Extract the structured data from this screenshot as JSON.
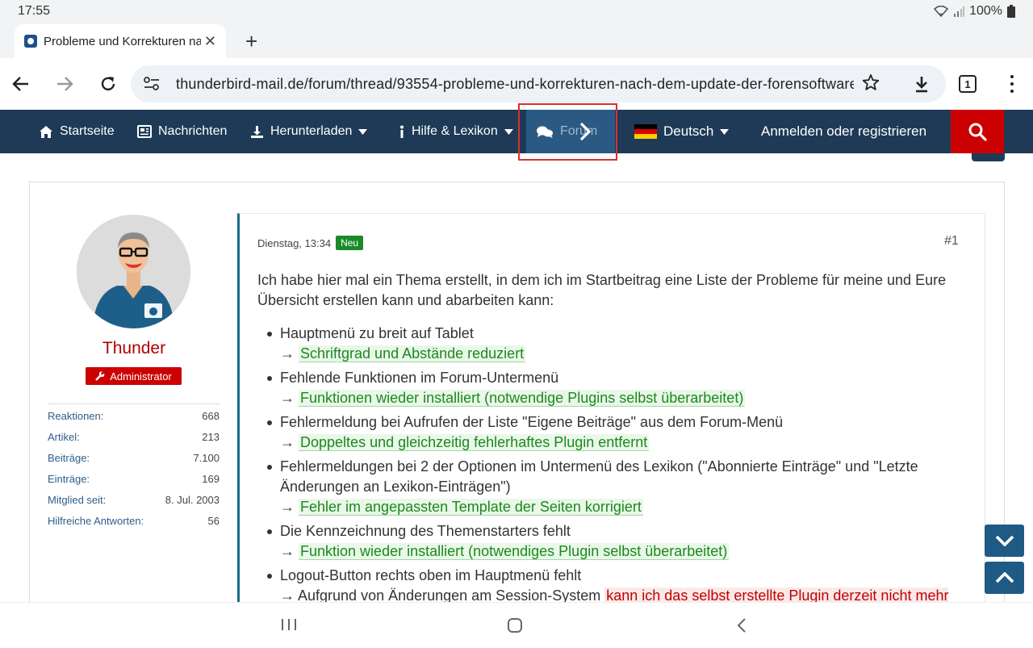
{
  "status_bar": {
    "time": "17:55",
    "battery": "100%"
  },
  "tab": {
    "title": "Probleme und Korrekturen nach dem Update"
  },
  "toolbar": {
    "url": "thunderbird-mail.de/forum/thread/93554-probleme-und-korrekturen-nach-dem-update-der-forensoftware",
    "tab_count": "1"
  },
  "nav": {
    "home": "Startseite",
    "news": "Nachrichten",
    "download": "Herunterladen",
    "help": "Hilfe & Lexikon",
    "forum": "Forum",
    "language": "Deutsch",
    "login": "Anmelden oder registrieren"
  },
  "user": {
    "name": "Thunder",
    "role": "Administrator",
    "stats": [
      {
        "label": "Reaktionen:",
        "value": "668"
      },
      {
        "label": "Artikel:",
        "value": "213"
      },
      {
        "label": "Beiträge:",
        "value": "7.100"
      },
      {
        "label": "Einträge:",
        "value": "169"
      },
      {
        "label": "Mitglied seit:",
        "value": "8. Jul. 2003"
      },
      {
        "label": "Hilfreiche Antworten:",
        "value": "56"
      }
    ]
  },
  "post": {
    "date": "Dienstag, 13:34",
    "badge": "Neu",
    "number": "#1",
    "intro": "Ich habe hier mal ein Thema erstellt, in dem ich im Startbeitrag eine Liste der Probleme für meine und Eure Übersicht erstellen kann und abarbeiten kann:",
    "arrow": "→",
    "items": [
      {
        "problem": "Hauptmenü zu breit auf Tablet",
        "fix": "Schriftgrad und Abstände reduziert"
      },
      {
        "problem": "Fehlende Funktionen im Forum-Untermenü",
        "fix": "Funktionen wieder installiert (notwendige Plugins selbst überarbeitet)"
      },
      {
        "problem": "Fehlermeldung bei Aufrufen der Liste \"Eigene Beiträge\" aus dem Forum-Menü",
        "fix": "Doppeltes und gleichzeitig fehlerhaftes Plugin entfernt"
      },
      {
        "problem": "Fehlermeldungen bei 2 der Optionen im Untermenü des Lexikon (\"Abonnierte Einträge\" und \"Letzte Änderungen an Lexikon-Einträgen\")",
        "fix": "Fehler im angepassten Template der Seiten korrigiert"
      },
      {
        "problem": "Die Kennzeichnung des Themenstarters fehlt",
        "fix": "Funktion wieder installiert (notwendiges Plugin selbst überarbeitet)"
      },
      {
        "problem": "Logout-Button rechts oben im Hauptmenü fehlt",
        "note": "Aufgrund von Änderungen am Session-System",
        "fix": "kann ich das selbst erstellte Plugin derzeit nicht mehr zum"
      }
    ]
  },
  "colors": {
    "nav_bg": "#1e3a57",
    "search_bg": "#cc0000",
    "fix_green": "#1a8a1a",
    "fix_red": "#c00000",
    "username": "#b30000"
  }
}
